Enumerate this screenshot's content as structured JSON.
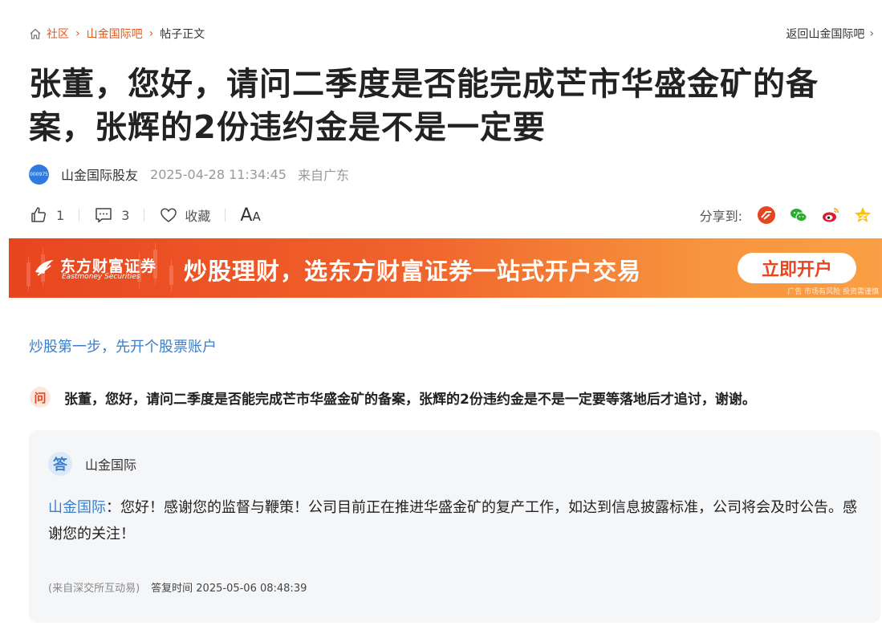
{
  "breadcrumb": {
    "items": [
      "社区",
      "山金国际吧"
    ],
    "current": "帖子正文",
    "back_link": "返回山金国际吧"
  },
  "post": {
    "title": "张董，您好，请问二季度是否能完成芒市华盛金矿的备案，张辉的2份违约金是不是一定要",
    "avatar_text": "000975",
    "author": "山金国际股友",
    "time": "2025-04-28 11:34:45",
    "location": "来自广东"
  },
  "actions": {
    "like_count": "1",
    "comment_count": "3",
    "favorite_label": "收藏",
    "font_big": "A",
    "font_small": "A",
    "share_label": "分享到:"
  },
  "banner": {
    "brand": "东方财富证券",
    "brand_en": "Eastmoney Securities",
    "slogan": "炒股理财，选东方财富证券一站式开户交易",
    "cta": "立即开户",
    "disclaimer": "广告 市场有风险 投资需谨慎"
  },
  "promo_link": "炒股第一步，先开个股票账户",
  "question": {
    "badge": "问",
    "text": "张董，您好，请问二季度是否能完成芒市华盛金矿的备案，张辉的2份违约金是不是一定要等落地后才追讨，谢谢。"
  },
  "answer": {
    "badge": "答",
    "company": "山金国际",
    "responder": "山金国际",
    "text": "：您好！感谢您的监督与鞭策！公司目前正在推进华盛金矿的复产工作，如达到信息披露标准，公司将会及时公告。感谢您的关注！",
    "source": "(来自深交所互动易)",
    "reply_time": "答复时间 2025-05-06 08:48:39"
  },
  "icons": {
    "home": "home-icon",
    "like": "thumbs-up-icon",
    "comment": "comment-icon",
    "favorite": "heart-icon",
    "share_targets": [
      "eastmoney-share-icon",
      "wechat-icon",
      "weibo-icon",
      "qzone-icon"
    ]
  },
  "colors": {
    "accent": "#e05a1e",
    "link_blue": "#3c7fc8",
    "banner_start": "#e8451f",
    "banner_end": "#fa9f45"
  }
}
